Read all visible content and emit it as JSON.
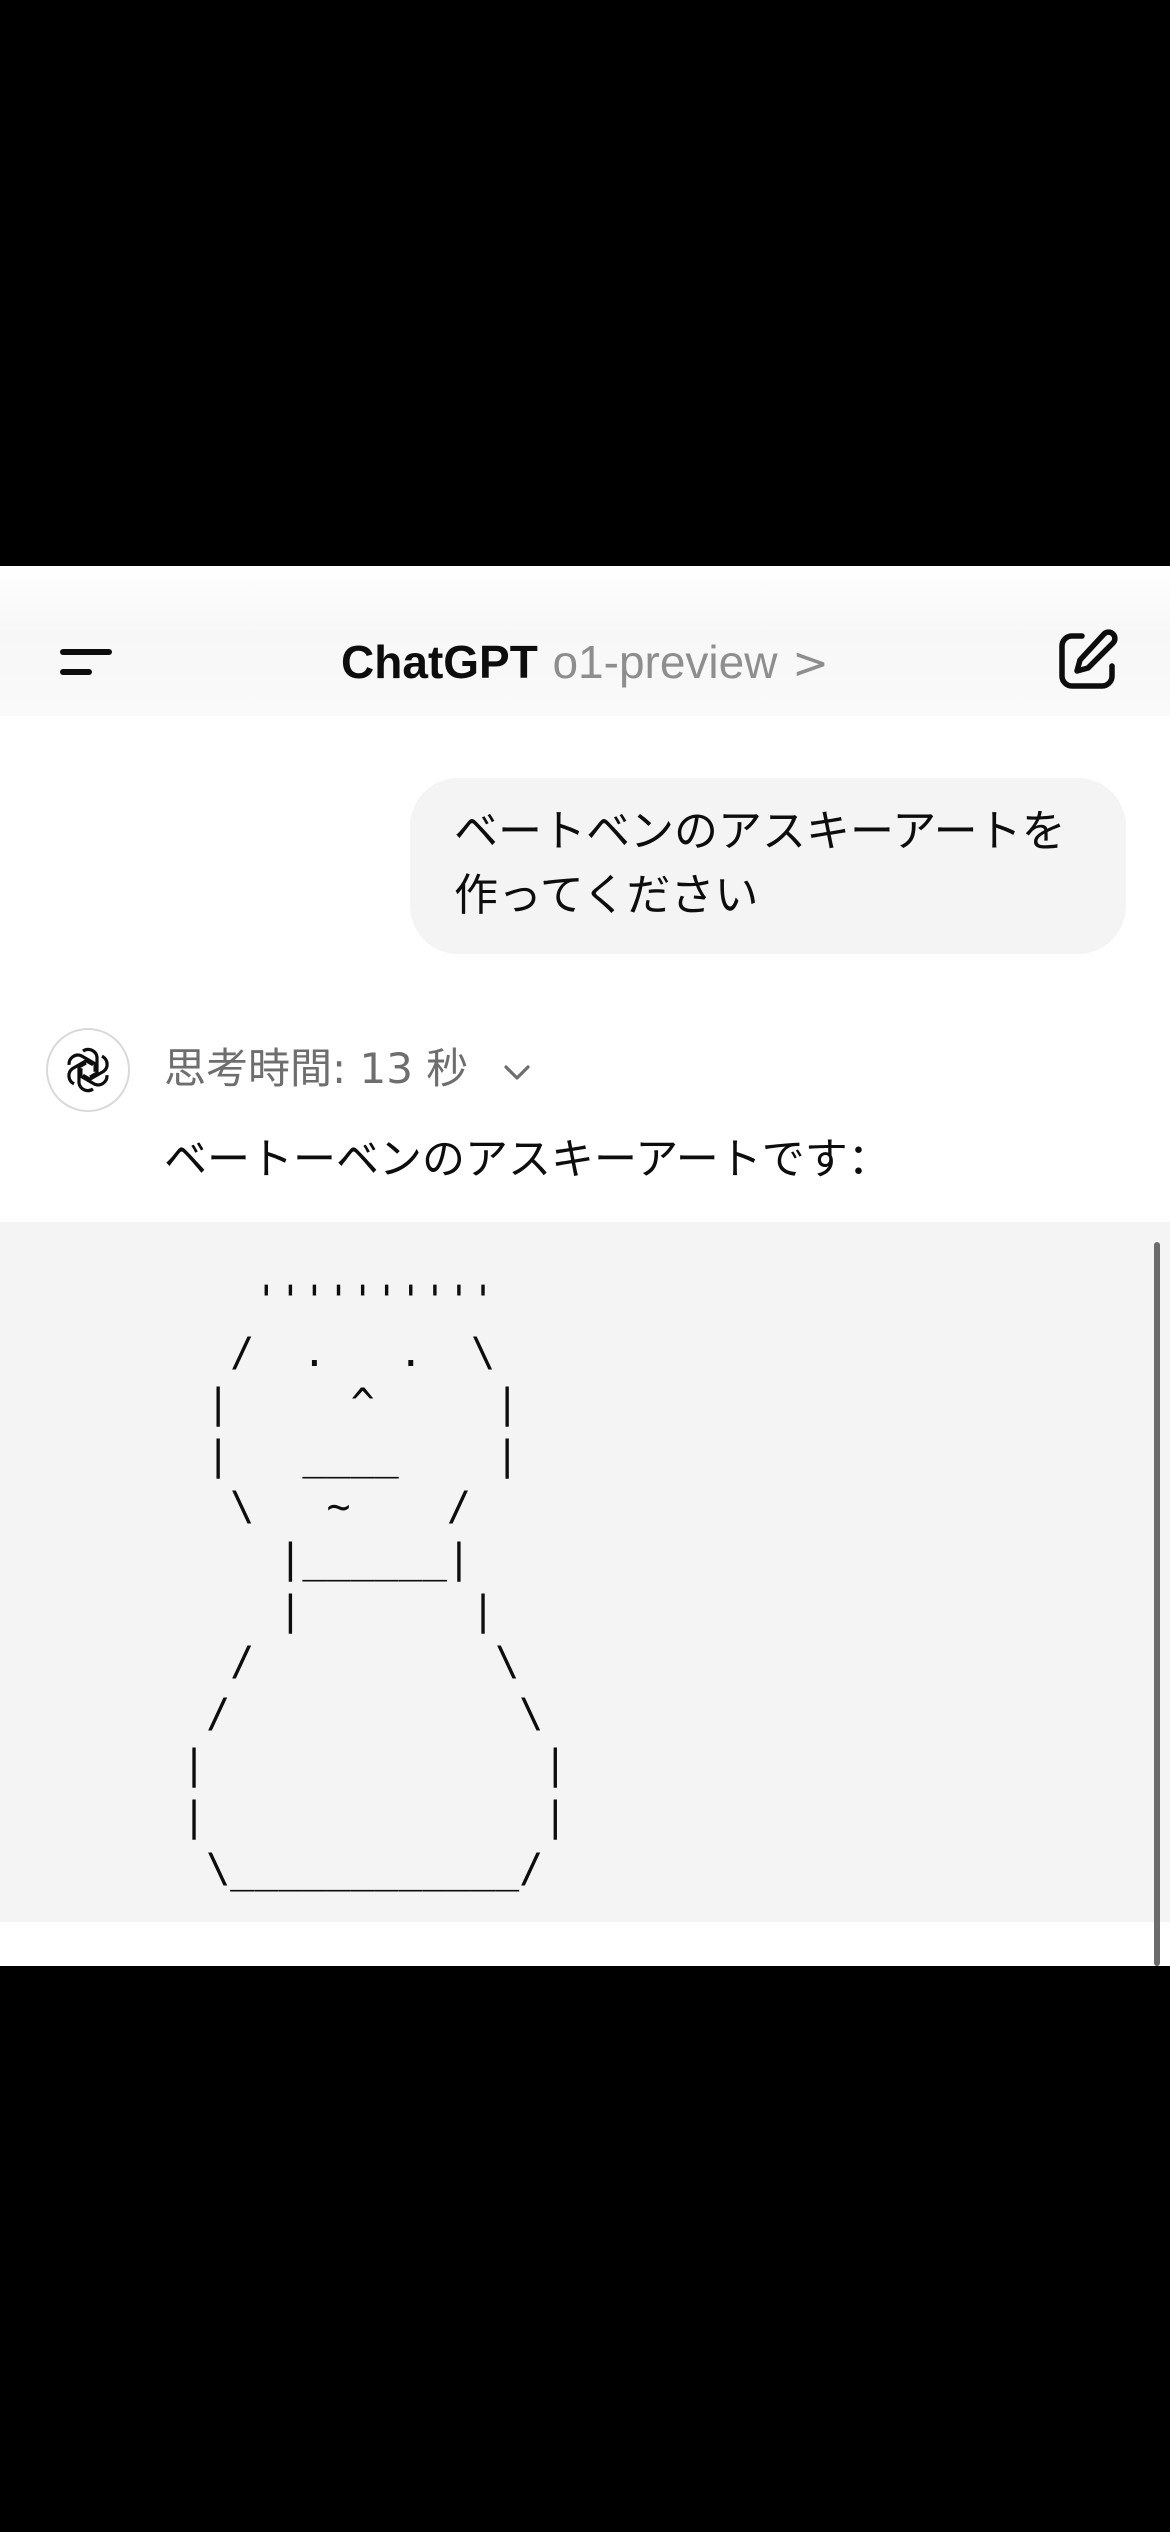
{
  "header": {
    "title": "ChatGPT",
    "model": "o1-preview",
    "chevron": ">"
  },
  "icons": {
    "menu": "menu-icon",
    "edit": "new-chat-edit-icon",
    "avatar": "openai-logo-icon",
    "expand": "chevron-down-icon"
  },
  "conversation": {
    "user_message": {
      "line1": "ベートベンのアスキーアートを",
      "line2": "作ってください"
    },
    "assistant": {
      "thinking_label": "思考時間: 13 秒",
      "intro_text": "ベートーベンのアスキーアートです："
    },
    "code_block": "   ''''''''''\n  /  .   .  \\\n |     ^     |\n |   ____    |\n  \\   ~    /\n    |______|\n    |       |\n  /          \\\n /            \\\n|              |\n|              |\n \\____________/"
  },
  "colors": {
    "brand_text": "#0d0d0d",
    "muted_text": "#8e8e8e",
    "bubble_bg": "#f4f4f4",
    "code_bg": "#f4f4f5"
  }
}
